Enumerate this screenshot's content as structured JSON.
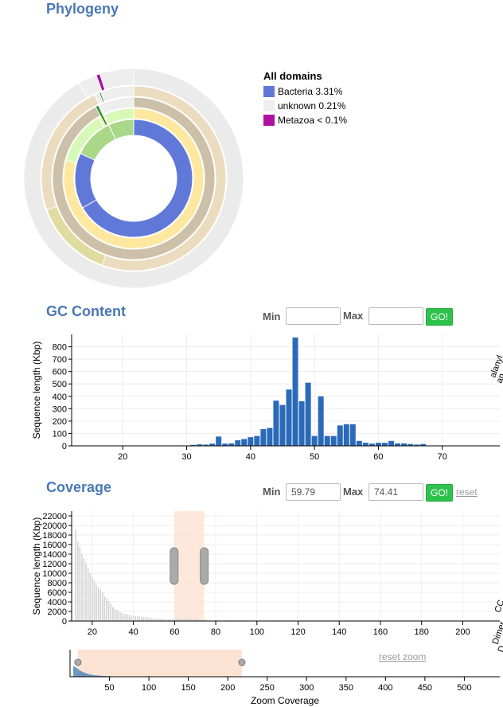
{
  "phylogeny": {
    "title": "Phylogeny",
    "legend": {
      "title": "All domains",
      "items": [
        {
          "label": "Bacteria 3.31%",
          "color": "#6078d8"
        },
        {
          "label": "unknown 0.21%",
          "color": "#eeeeee"
        },
        {
          "label": "Metazoa < 0.1%",
          "color": "#b010a0"
        }
      ]
    }
  },
  "gc": {
    "title": "GC Content",
    "min_label": "Min",
    "max_label": "Max",
    "min_value": "",
    "max_value": "",
    "go_label": "GO!",
    "right_clipped_text": [
      "alanyl",
      "an"
    ]
  },
  "coverage": {
    "title": "Coverage",
    "min_label": "Min",
    "max_label": "Max",
    "min_value": "59.79",
    "max_value": "74.41",
    "go_label": "GO!",
    "reset_label": "reset",
    "reset_zoom_label": "reset zoom",
    "right_clipped_text": [
      "CC",
      "Dimer",
      "D"
    ]
  },
  "chart_data": [
    {
      "type": "bar",
      "name": "gc-histogram",
      "title": "",
      "xlabel": "",
      "ylabel": "Sequence length (Kbp)",
      "xlim": [
        12,
        79
      ],
      "ylim": [
        0,
        900
      ],
      "xticks": [
        20,
        30,
        40,
        50,
        60,
        70
      ],
      "yticks": [
        0,
        100,
        200,
        300,
        400,
        500,
        600,
        700,
        800
      ],
      "x": [
        30,
        31,
        32,
        33,
        34,
        35,
        36,
        37,
        38,
        39,
        40,
        41,
        42,
        43,
        44,
        45,
        46,
        47,
        48,
        49,
        50,
        51,
        52,
        53,
        54,
        55,
        56,
        57,
        58,
        59,
        60,
        61,
        62,
        63,
        64,
        65,
        66,
        67
      ],
      "values": [
        3,
        8,
        12,
        10,
        18,
        75,
        18,
        20,
        45,
        55,
        70,
        80,
        135,
        145,
        365,
        330,
        455,
        875,
        360,
        510,
        80,
        400,
        80,
        80,
        165,
        175,
        175,
        40,
        25,
        18,
        25,
        25,
        40,
        20,
        20,
        15,
        10,
        15
      ],
      "bar_color": "#2a6ab8",
      "grid": true
    },
    {
      "type": "bar",
      "name": "coverage-histogram",
      "title": "",
      "xlabel": "",
      "ylabel": "Sequence length (Kbp)",
      "xlim": [
        10,
        218
      ],
      "ylim": [
        0,
        23000
      ],
      "xticks": [
        20,
        40,
        60,
        80,
        100,
        120,
        140,
        160,
        180,
        200
      ],
      "yticks": [
        0,
        2000,
        4000,
        6000,
        8000,
        10000,
        12000,
        14000,
        16000,
        18000,
        20000,
        22000
      ],
      "x": [
        12,
        13,
        14,
        15,
        16,
        17,
        18,
        19,
        20,
        21,
        22,
        23,
        24,
        25,
        26,
        27,
        28,
        29,
        30,
        31,
        32,
        33,
        34,
        35,
        36,
        37,
        38,
        39,
        40,
        41,
        42,
        43,
        44,
        45,
        46,
        47,
        48,
        49,
        50,
        51,
        52,
        53,
        54,
        55,
        56,
        57,
        58,
        59,
        60,
        61,
        62,
        63,
        64,
        65,
        66,
        67,
        68,
        69,
        70,
        71,
        72,
        73,
        74,
        75,
        80,
        85,
        90,
        95,
        100,
        110,
        120
      ],
      "values": [
        19000,
        16500,
        15500,
        14000,
        13000,
        12000,
        11000,
        10000,
        9200,
        8500,
        7500,
        7000,
        6600,
        6000,
        5200,
        4800,
        4200,
        3600,
        3000,
        2600,
        2300,
        2000,
        1800,
        1600,
        1500,
        1400,
        1300,
        1200,
        1100,
        1000,
        1000,
        900,
        900,
        800,
        800,
        700,
        650,
        600,
        600,
        550,
        500,
        500,
        450,
        450,
        400,
        400,
        380,
        360,
        350,
        600,
        500,
        450,
        400,
        450,
        600,
        500,
        450,
        400,
        600,
        450,
        400,
        300,
        300,
        300,
        200,
        200,
        150,
        150,
        100,
        100,
        80
      ],
      "bar_color": "#d4d4d4",
      "selection": [
        59.79,
        74.41
      ],
      "grid": true
    },
    {
      "type": "area",
      "name": "zoom-coverage",
      "title": "",
      "xlabel": "Zoom Coverage",
      "ylabel": "",
      "xlim": [
        0,
        545
      ],
      "xticks": [
        50,
        100,
        150,
        200,
        250,
        300,
        350,
        400,
        450,
        500
      ],
      "x": [
        4,
        8,
        12,
        16,
        20,
        25,
        30,
        40,
        50,
        60,
        80,
        100
      ],
      "values": [
        1.0,
        0.85,
        0.6,
        0.45,
        0.32,
        0.22,
        0.15,
        0.08,
        0.05,
        0.03,
        0.02,
        0.01
      ],
      "color": "#4a7fb8",
      "brush": [
        10,
        218
      ]
    }
  ]
}
